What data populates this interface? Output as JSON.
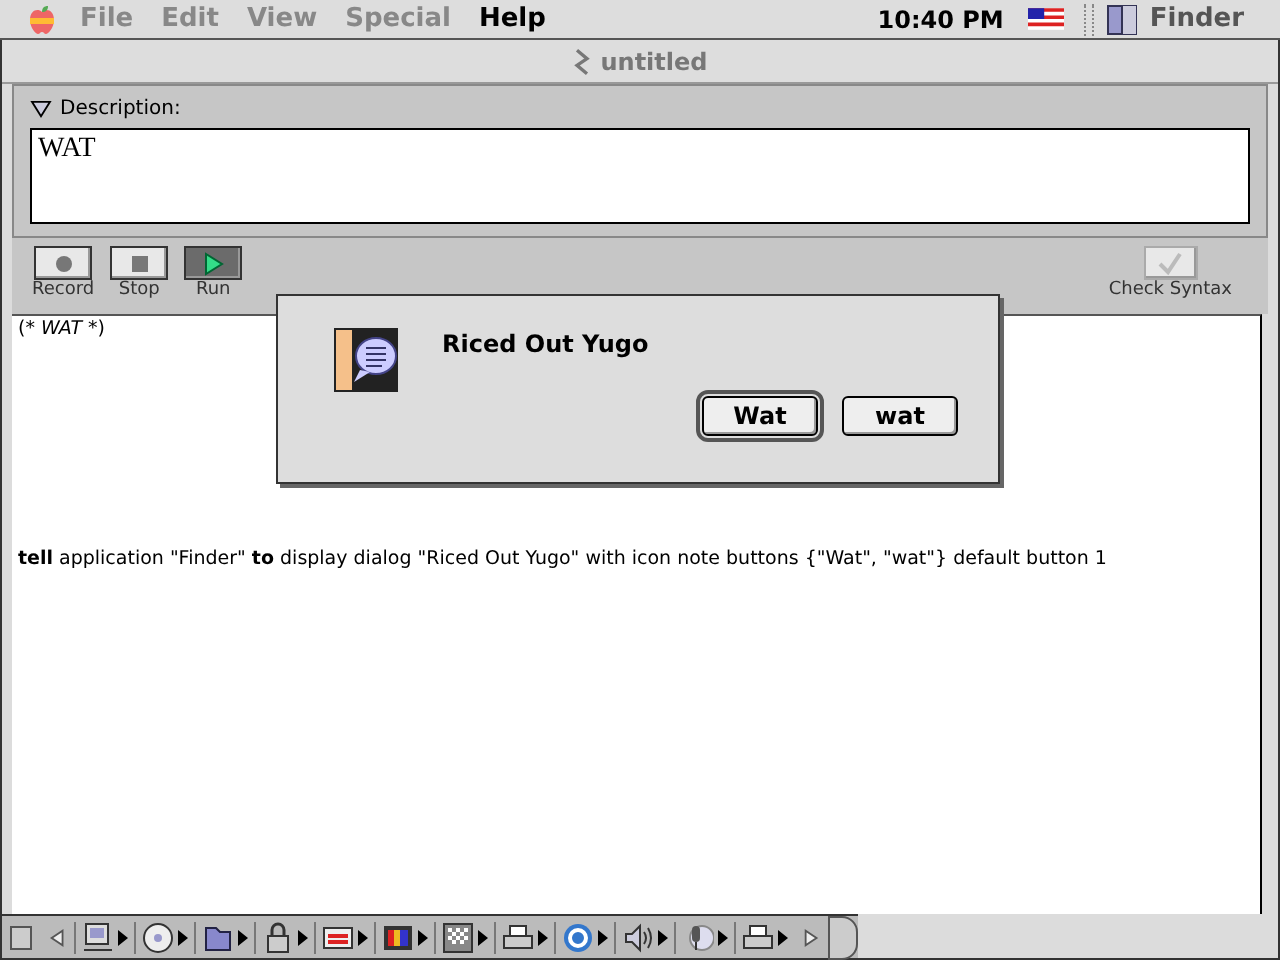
{
  "menu_bar": {
    "items": [
      {
        "label": "File",
        "disabled": true
      },
      {
        "label": "Edit",
        "disabled": true
      },
      {
        "label": "View",
        "disabled": true
      },
      {
        "label": "Special",
        "disabled": true
      },
      {
        "label": "Help",
        "disabled": false
      }
    ],
    "clock": "10:40 PM",
    "app": "Finder"
  },
  "window": {
    "title": "untitled"
  },
  "description": {
    "label": "Description:",
    "expanded": true,
    "value": "WAT"
  },
  "toolbar": {
    "buttons": [
      {
        "label": "Record",
        "kind": "record",
        "active": false
      },
      {
        "label": "Stop",
        "kind": "stop",
        "active": false
      },
      {
        "label": "Run",
        "kind": "run",
        "active": true
      }
    ],
    "check_syntax": {
      "label": "Check Syntax",
      "disabled": true
    }
  },
  "script": {
    "lines": [
      "(* *WAT* *)",
      "**tell** application \"Finder\" **to** display dialog \"Riced Out Yugo\" with icon note buttons {\"Wat\", \"wat\"} default button 1"
    ]
  },
  "dialog": {
    "message": "Riced Out Yugo",
    "buttons": [
      {
        "label": "Wat",
        "default": true
      },
      {
        "label": "wat",
        "default": false
      }
    ]
  }
}
